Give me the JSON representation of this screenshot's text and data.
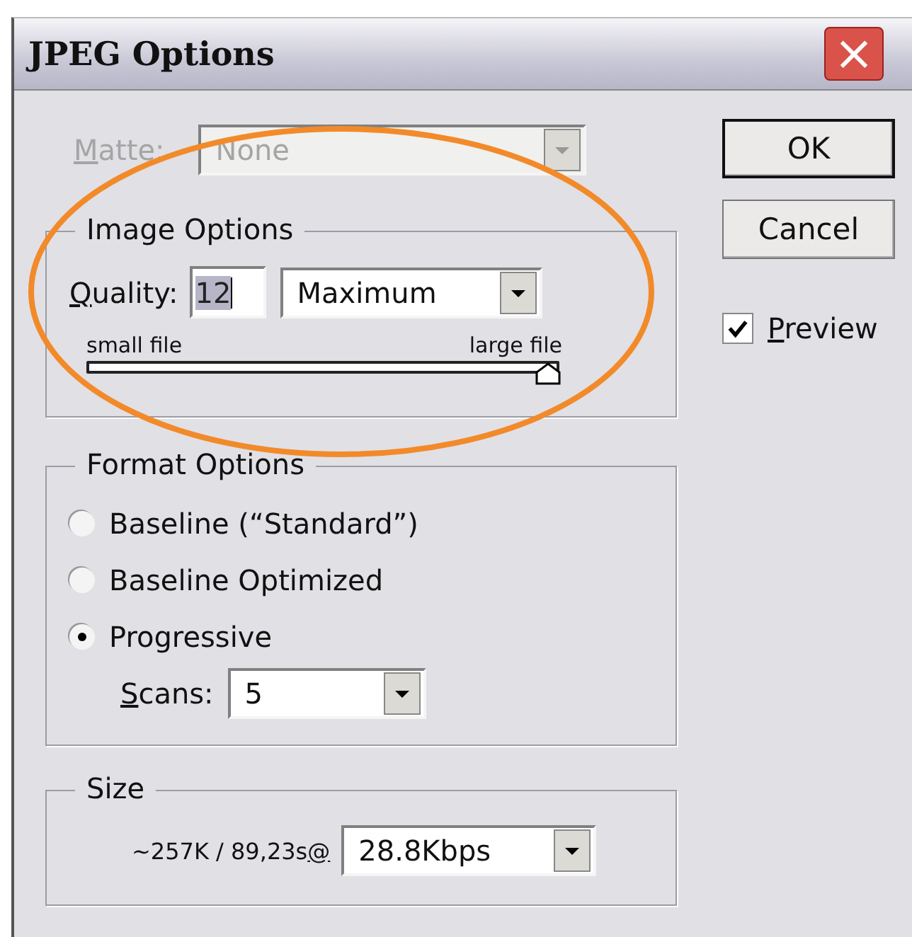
{
  "window": {
    "title": "JPEG Options",
    "close": "×"
  },
  "matte": {
    "label": "Matte:",
    "value": "None",
    "disabled": true
  },
  "buttons": [
    {
      "label": "OK",
      "default": true
    },
    {
      "label": "Cancel",
      "default": false
    }
  ],
  "preview": {
    "label": "Preview",
    "checked": true
  },
  "image_options": {
    "title": "Image Options",
    "quality_label": "Quality:",
    "quality_value": "12",
    "preset": "Maximum",
    "slider_min_label": "small file",
    "slider_max_label": "large file",
    "level": 1.0
  },
  "format_options": {
    "title": "Format Options",
    "choices": [
      {
        "label": "Baseline (“Standard”)",
        "selected": false
      },
      {
        "label": "Baseline Optimized",
        "selected": false
      },
      {
        "label": "Progressive",
        "selected": true
      }
    ],
    "scans_label": "Scans:",
    "scans_value": "5"
  },
  "size": {
    "title": "Size",
    "estimate": "~257K / 89,23s@",
    "speed": "28.8Kbps"
  }
}
